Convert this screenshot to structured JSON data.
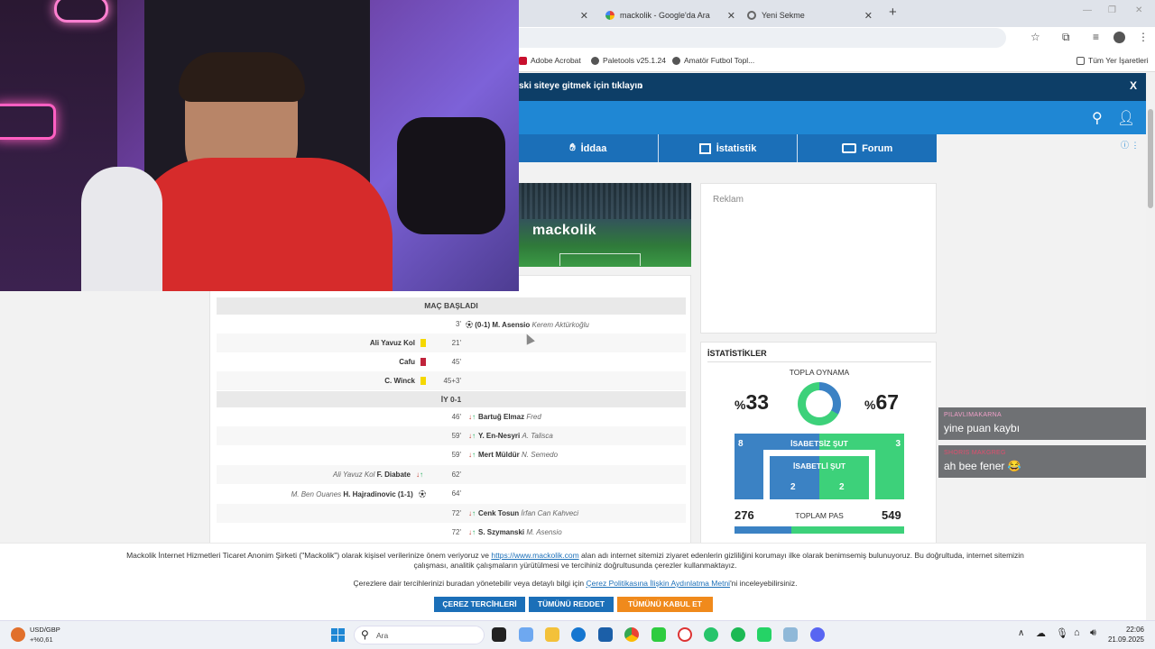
{
  "tabs": [
    {
      "label": "",
      "active": false
    },
    {
      "label": "mackolik - Google'da Ara",
      "active": false
    },
    {
      "label": "Yeni Sekme",
      "active": false
    }
  ],
  "bookmarks": [
    "Adobe Acrobat",
    "Paletools v25.1.24",
    "Amatör Futbol Topl...",
    "Tüm Yer İşaretleri"
  ],
  "promo": {
    "text": "ski siteye gitmek için tıklayın",
    "arrow": "›",
    "close": "X"
  },
  "nav": [
    {
      "label": "İddaa",
      "icon": "ball-hand-icon"
    },
    {
      "label": "İstatistik",
      "icon": "chart-icon"
    },
    {
      "label": "Forum",
      "icon": "forum-icon"
    }
  ],
  "banner": {
    "logo": "mackolik"
  },
  "ad": {
    "label": "Reklam"
  },
  "events": {
    "start_label": "MAÇ BAŞLADI",
    "half_label": "İY 0-1",
    "rows_first": [
      {
        "min": "3'",
        "away_bold": "(0-1) M. Asensio",
        "away_italic": "Kerem Aktürkoğlu",
        "home": "",
        "type": "goal-away"
      },
      {
        "min": "21'",
        "home": "Ali Yavuz Kol",
        "type": "yellow-home"
      },
      {
        "min": "45'",
        "home": "Cafu",
        "type": "red-home"
      },
      {
        "min": "45+3'",
        "home": "C. Winck",
        "type": "yellow-home"
      }
    ],
    "rows_second": [
      {
        "min": "46'",
        "away_bold": "Bartuğ Elmaz",
        "away_italic": "Fred",
        "type": "sub-away"
      },
      {
        "min": "59'",
        "away_bold": "Y. En-Nesyri",
        "away_italic": "A. Talisca",
        "type": "sub-away"
      },
      {
        "min": "59'",
        "away_bold": "Mert Müldür",
        "away_italic": "N. Semedo",
        "type": "sub-away"
      },
      {
        "min": "62'",
        "home_italic": "Ali Yavuz Kol",
        "home_bold": "F. Diabate",
        "type": "sub-home"
      },
      {
        "min": "64'",
        "home_italic": "M. Ben Ouanes",
        "home_bold": "H. Hajradinovic (1-1)",
        "type": "goal-home"
      },
      {
        "min": "72'",
        "away_bold": "Cenk Tosun",
        "away_italic": "İrfan Can Kahveci",
        "type": "sub-away"
      },
      {
        "min": "72'",
        "away_bold": "S. Szymanski",
        "away_italic": "M. Asensio",
        "type": "sub-away"
      }
    ]
  },
  "stats": {
    "title": "İSTATİSTİKLER",
    "possession_label": "TOPLA OYNAMA",
    "possession_home_pct": "%",
    "possession_home": "33",
    "possession_away_pct": "%",
    "possession_away": "67",
    "off_target_label": "İSABETSİZ ŞUT",
    "off_target_home": "8",
    "off_target_away": "3",
    "on_target_label": "İSABETLİ ŞUT",
    "on_target_home": "2",
    "on_target_away": "2",
    "passes_label": "TOPLAM PAS",
    "passes_home": "276",
    "passes_away": "549",
    "home_color": "#3b82c4",
    "away_color": "#3dd17a"
  },
  "chat": [
    {
      "user": "PILAVLIMAKARNA",
      "message": "yine puan kaybı",
      "user_color": "#f0a0c8"
    },
    {
      "user": "SHORIS MAKGREG",
      "message": "ah bee fener 😂",
      "user_color": "#e04e6e"
    }
  ],
  "cookie": {
    "text_a": "Mackolik İnternet Hizmetleri Ticaret Anonim Şirketi (\"Mackolik\") olarak kişisel verilerinize önem veriyoruz ve",
    "link_a": "https://www.mackolik.com",
    "text_b": "alan adı internet sitemizi ziyaret edenlerin gizliliğini korumayı ilke olarak benimsemiş bulunuyoruz. Bu doğrultuda, internet sitemizin çalışması, analitik çalışmaların yürütülmesi ve tercihiniz doğrultusunda çerezler kullanmaktayız.",
    "text_c": "Çerezlere dair tercihlerinizi buradan yönetebilir veya detaylı bilgi için",
    "link_c": "Çerez Politikasına İlişkin Aydınlatma Metni",
    "text_d": "'ni inceleyebilirsiniz.",
    "btn_prefs": "ÇEREZ TERCİHLERİ",
    "btn_reject": "TÜMÜNÜ REDDET",
    "btn_accept": "TÜMÜNÜ KABUL ET"
  },
  "taskbar": {
    "ticker_name": "USD/GBP",
    "ticker_change": "+%0,61",
    "search_placeholder": "Ara",
    "time": "22:06",
    "date": "21.09.2025"
  }
}
